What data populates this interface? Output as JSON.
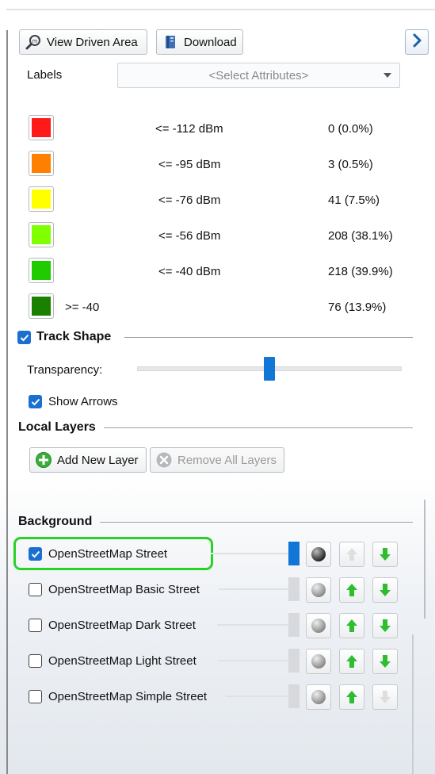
{
  "toolbar": {
    "view_driven_area": "View Driven Area",
    "download": "Download"
  },
  "labels": {
    "label": "Labels",
    "select_placeholder": "<Select Attributes>"
  },
  "legend": [
    {
      "color": "#ff1a1a",
      "label": "<= -112 dBm",
      "count": "0 (0.0%)"
    },
    {
      "color": "#ff8000",
      "label": "<= -95 dBm",
      "count": "3 (0.5%)"
    },
    {
      "color": "#ffff00",
      "label": "<= -76 dBm",
      "count": "41 (7.5%)"
    },
    {
      "color": "#80ff00",
      "label": "<= -56 dBm",
      "count": "208 (38.1%)"
    },
    {
      "color": "#20cc00",
      "label": "<= -40 dBm",
      "count": "218 (39.9%)"
    },
    {
      "color": "#1a8000",
      "label": ">= -40",
      "count": "76 (13.9%)"
    }
  ],
  "track_shape": {
    "title": "Track Shape",
    "checked": true,
    "transparency_label": "Transparency:",
    "transparency_value": 0.5,
    "show_arrows_label": "Show Arrows",
    "show_arrows_checked": true
  },
  "local_layers": {
    "title": "Local Layers",
    "add_new_layer": "Add New Layer",
    "remove_all_layers": "Remove All Layers"
  },
  "background": {
    "title": "Background",
    "layers": [
      {
        "label": "OpenStreetMap Street",
        "checked": true
      },
      {
        "label": "OpenStreetMap Basic Street",
        "checked": false
      },
      {
        "label": "OpenStreetMap Dark Street",
        "checked": false
      },
      {
        "label": "OpenStreetMap Light Street",
        "checked": false
      },
      {
        "label": "OpenStreetMap Simple Street",
        "checked": false
      }
    ]
  },
  "colors": {
    "accent": "#1276d6",
    "highlight": "#2bd226",
    "arrow_green": "#2ebd2e"
  }
}
